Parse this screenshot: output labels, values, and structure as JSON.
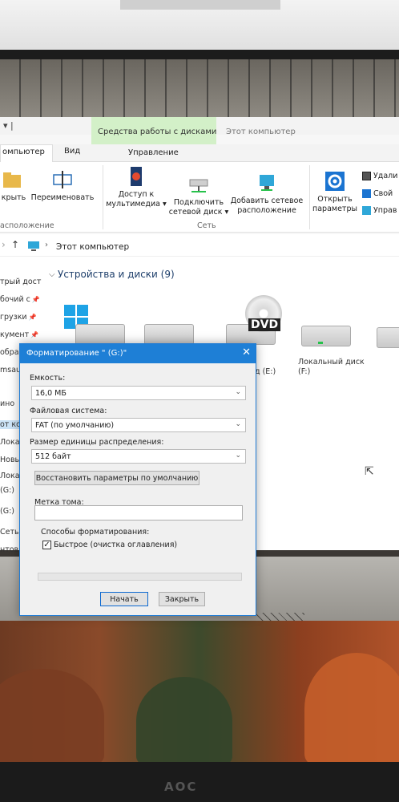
{
  "explorer": {
    "qa_glyph": "▾ |",
    "contextual_tab_group": "Средства работы с дисками",
    "window_title": "Этот компьютер",
    "tabs": [
      "омпьютер",
      "Вид",
      "Управление"
    ],
    "ribbon": {
      "rename_area_label": "крыть",
      "rename": "Переименовать",
      "location_group": "асположение",
      "media_access_1": "Доступ к",
      "media_access_2": "мультимедиа ▾",
      "map_drive_1": "Подключить",
      "map_drive_2": "сетевой диск ▾",
      "add_location_1": "Добавить сетевое",
      "add_location_2": "расположение",
      "network_group": "Сеть",
      "open_settings_1": "Открыть",
      "open_settings_2": "параметры",
      "uninstall": "Удали",
      "properties": "Свой",
      "manage": "Управ"
    },
    "address": "Этот компьютер",
    "nav_items": [
      "трый дост",
      "бочий с",
      "грузки",
      "кумент",
      "обра",
      "msau",
      "ино",
      "от комп",
      "Локаль",
      "Новый",
      "Локаль",
      "(G:)",
      "(G:)",
      "Сеть"
    ],
    "status": "нтов: 9",
    "section_title": "Устройства и диски (9)",
    "drive_e_label": "д (E:)",
    "drive_f_label_1": "Локальный диск",
    "drive_f_label_2": "(F:)",
    "dvd_text": "DVD"
  },
  "dialog": {
    "title": "Форматирование \" (G:)\"",
    "capacity_label": "Емкость:",
    "capacity_value": "16,0 МБ",
    "fs_label": "Файловая система:",
    "fs_value": "FAT (по умолчанию)",
    "alloc_label": "Размер единицы распределения:",
    "alloc_value": "512 байт",
    "restore_label": "Восстановить параметры по умолчанию",
    "volume_label": "Метка тома:",
    "volume_value": "",
    "format_options_label": "Способы форматирования:",
    "quick_format_label": "Быстрое (очистка оглавления)",
    "quick_format_checked": true,
    "progress": 0,
    "start_label": "Начать",
    "close_label": "Закрыть"
  },
  "monitor": {
    "brand": "AOC"
  },
  "colors": {
    "accent": "#1e7fd6",
    "context_tab": "#d3f0c8",
    "drive_led": "#27c24b"
  }
}
